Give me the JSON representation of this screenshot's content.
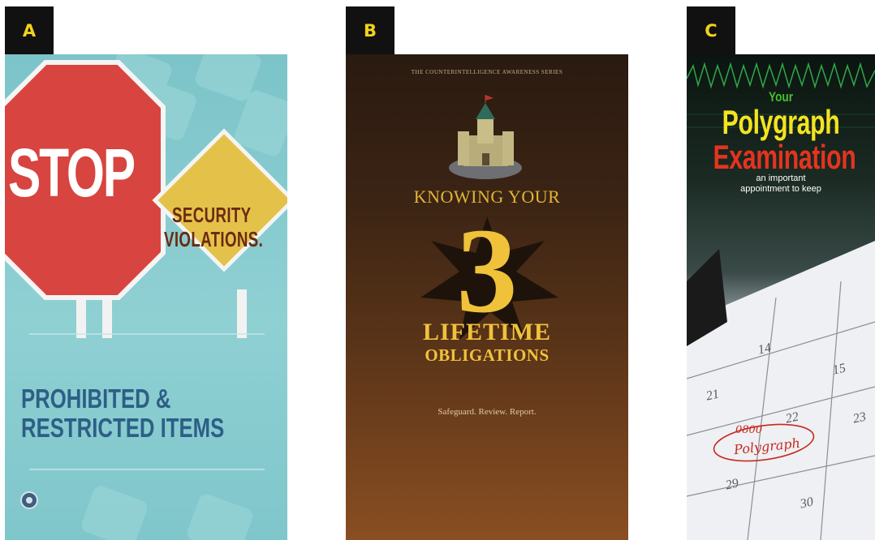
{
  "labels": {
    "a": "A",
    "b": "B",
    "c": "C"
  },
  "panel_a": {
    "stop": "STOP",
    "security_line1": "SECURITY",
    "security_line2": "VIOLATIONS.",
    "prohibited_line1": "PROHIBITED &",
    "prohibited_line2": "RESTRICTED ITEMS"
  },
  "panel_b": {
    "top_line": "THE COUNTERINTELLIGENCE AWARENESS SERIES",
    "knowing": "KNOWING YOUR",
    "number": "3",
    "lifetime": "LIFETIME",
    "obligations": "OBLIGATIONS",
    "tagline": "Safeguard. Review. Report."
  },
  "panel_c": {
    "your": "Your",
    "polygraph": "Polygraph",
    "examination": "Examination",
    "subtitle_line1": "an important",
    "subtitle_line2": "appointment to keep",
    "calendar_numbers": [
      "14",
      "15",
      "21",
      "22",
      "23",
      "29",
      "30"
    ],
    "note_time": "0800",
    "note_text": "Polygraph"
  },
  "colors": {
    "tag_bg": "#111111",
    "tag_text": "#f2d31a",
    "stop_red": "#d8443f",
    "sign_yellow": "#e4c24a",
    "gold": "#f0c23a",
    "poly_yellow": "#f4e320",
    "exam_red": "#e5331f",
    "your_green": "#46c22a"
  }
}
